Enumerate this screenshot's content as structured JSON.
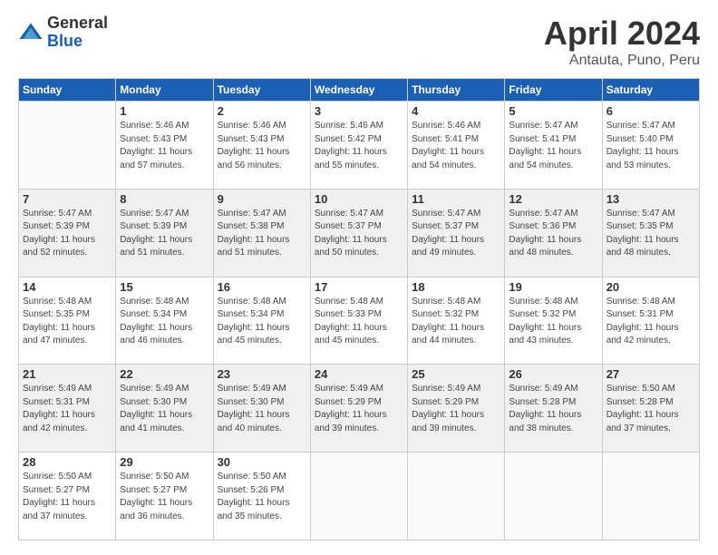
{
  "logo": {
    "general": "General",
    "blue": "Blue"
  },
  "title": "April 2024",
  "location": "Antauta, Puno, Peru",
  "weekdays": [
    "Sunday",
    "Monday",
    "Tuesday",
    "Wednesday",
    "Thursday",
    "Friday",
    "Saturday"
  ],
  "weeks": [
    [
      {
        "day": "",
        "info": ""
      },
      {
        "day": "1",
        "info": "Sunrise: 5:46 AM\nSunset: 5:43 PM\nDaylight: 11 hours\nand 57 minutes."
      },
      {
        "day": "2",
        "info": "Sunrise: 5:46 AM\nSunset: 5:43 PM\nDaylight: 11 hours\nand 56 minutes."
      },
      {
        "day": "3",
        "info": "Sunrise: 5:46 AM\nSunset: 5:42 PM\nDaylight: 11 hours\nand 55 minutes."
      },
      {
        "day": "4",
        "info": "Sunrise: 5:46 AM\nSunset: 5:41 PM\nDaylight: 11 hours\nand 54 minutes."
      },
      {
        "day": "5",
        "info": "Sunrise: 5:47 AM\nSunset: 5:41 PM\nDaylight: 11 hours\nand 54 minutes."
      },
      {
        "day": "6",
        "info": "Sunrise: 5:47 AM\nSunset: 5:40 PM\nDaylight: 11 hours\nand 53 minutes."
      }
    ],
    [
      {
        "day": "7",
        "info": "Sunrise: 5:47 AM\nSunset: 5:39 PM\nDaylight: 11 hours\nand 52 minutes."
      },
      {
        "day": "8",
        "info": "Sunrise: 5:47 AM\nSunset: 5:39 PM\nDaylight: 11 hours\nand 51 minutes."
      },
      {
        "day": "9",
        "info": "Sunrise: 5:47 AM\nSunset: 5:38 PM\nDaylight: 11 hours\nand 51 minutes."
      },
      {
        "day": "10",
        "info": "Sunrise: 5:47 AM\nSunset: 5:37 PM\nDaylight: 11 hours\nand 50 minutes."
      },
      {
        "day": "11",
        "info": "Sunrise: 5:47 AM\nSunset: 5:37 PM\nDaylight: 11 hours\nand 49 minutes."
      },
      {
        "day": "12",
        "info": "Sunrise: 5:47 AM\nSunset: 5:36 PM\nDaylight: 11 hours\nand 48 minutes."
      },
      {
        "day": "13",
        "info": "Sunrise: 5:47 AM\nSunset: 5:35 PM\nDaylight: 11 hours\nand 48 minutes."
      }
    ],
    [
      {
        "day": "14",
        "info": "Sunrise: 5:48 AM\nSunset: 5:35 PM\nDaylight: 11 hours\nand 47 minutes."
      },
      {
        "day": "15",
        "info": "Sunrise: 5:48 AM\nSunset: 5:34 PM\nDaylight: 11 hours\nand 46 minutes."
      },
      {
        "day": "16",
        "info": "Sunrise: 5:48 AM\nSunset: 5:34 PM\nDaylight: 11 hours\nand 45 minutes."
      },
      {
        "day": "17",
        "info": "Sunrise: 5:48 AM\nSunset: 5:33 PM\nDaylight: 11 hours\nand 45 minutes."
      },
      {
        "day": "18",
        "info": "Sunrise: 5:48 AM\nSunset: 5:32 PM\nDaylight: 11 hours\nand 44 minutes."
      },
      {
        "day": "19",
        "info": "Sunrise: 5:48 AM\nSunset: 5:32 PM\nDaylight: 11 hours\nand 43 minutes."
      },
      {
        "day": "20",
        "info": "Sunrise: 5:48 AM\nSunset: 5:31 PM\nDaylight: 11 hours\nand 42 minutes."
      }
    ],
    [
      {
        "day": "21",
        "info": "Sunrise: 5:49 AM\nSunset: 5:31 PM\nDaylight: 11 hours\nand 42 minutes."
      },
      {
        "day": "22",
        "info": "Sunrise: 5:49 AM\nSunset: 5:30 PM\nDaylight: 11 hours\nand 41 minutes."
      },
      {
        "day": "23",
        "info": "Sunrise: 5:49 AM\nSunset: 5:30 PM\nDaylight: 11 hours\nand 40 minutes."
      },
      {
        "day": "24",
        "info": "Sunrise: 5:49 AM\nSunset: 5:29 PM\nDaylight: 11 hours\nand 39 minutes."
      },
      {
        "day": "25",
        "info": "Sunrise: 5:49 AM\nSunset: 5:29 PM\nDaylight: 11 hours\nand 39 minutes."
      },
      {
        "day": "26",
        "info": "Sunrise: 5:49 AM\nSunset: 5:28 PM\nDaylight: 11 hours\nand 38 minutes."
      },
      {
        "day": "27",
        "info": "Sunrise: 5:50 AM\nSunset: 5:28 PM\nDaylight: 11 hours\nand 37 minutes."
      }
    ],
    [
      {
        "day": "28",
        "info": "Sunrise: 5:50 AM\nSunset: 5:27 PM\nDaylight: 11 hours\nand 37 minutes."
      },
      {
        "day": "29",
        "info": "Sunrise: 5:50 AM\nSunset: 5:27 PM\nDaylight: 11 hours\nand 36 minutes."
      },
      {
        "day": "30",
        "info": "Sunrise: 5:50 AM\nSunset: 5:26 PM\nDaylight: 11 hours\nand 35 minutes."
      },
      {
        "day": "",
        "info": ""
      },
      {
        "day": "",
        "info": ""
      },
      {
        "day": "",
        "info": ""
      },
      {
        "day": "",
        "info": ""
      }
    ]
  ]
}
